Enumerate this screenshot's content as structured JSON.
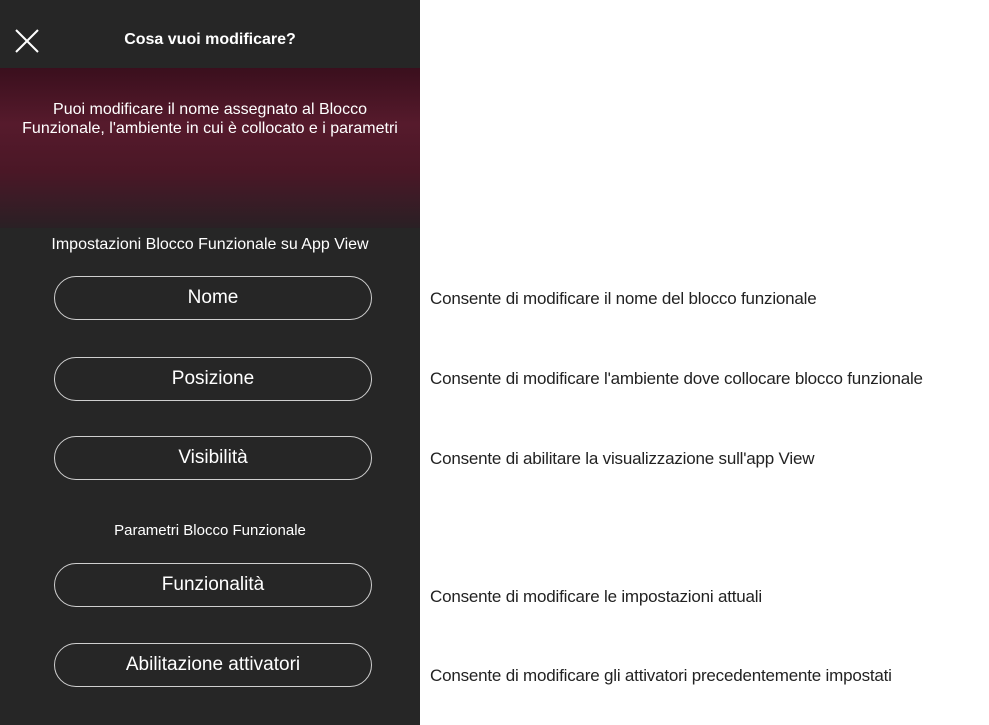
{
  "header": {
    "title": "Cosa vuoi modificare?"
  },
  "banner": {
    "text": "Puoi modificare il nome assegnato al Blocco Funzionale, l'ambiente in cui è collocato e i parametri"
  },
  "sections": {
    "app_view_heading": "Impostazioni Blocco Funzionale su App View",
    "params_heading": "Parametri Blocco Funzionale"
  },
  "buttons": {
    "nome": "Nome",
    "posizione": "Posizione",
    "visibilita": "Visibilità",
    "funzionalita": "Funzionalità",
    "abilitazione": "Abilitazione attivatori"
  },
  "descriptions": {
    "nome": "Consente di modificare il nome del blocco funzionale",
    "posizione": "Consente di modificare l'ambiente dove collocare blocco funzionale",
    "visibilita": "Consente di abilitare la visualizzazione sull'app View",
    "funzionalita": "Consente di modificare le impostazioni attuali",
    "abilitazione": "Consente di modificare gli attivatori precedentemente impostati"
  },
  "icons": {
    "close": "close-icon"
  },
  "colors": {
    "panel_bg": "#262626",
    "banner_accent": "#561a2c",
    "text_on_dark": "#ffffff",
    "annotation_text": "#222222"
  }
}
